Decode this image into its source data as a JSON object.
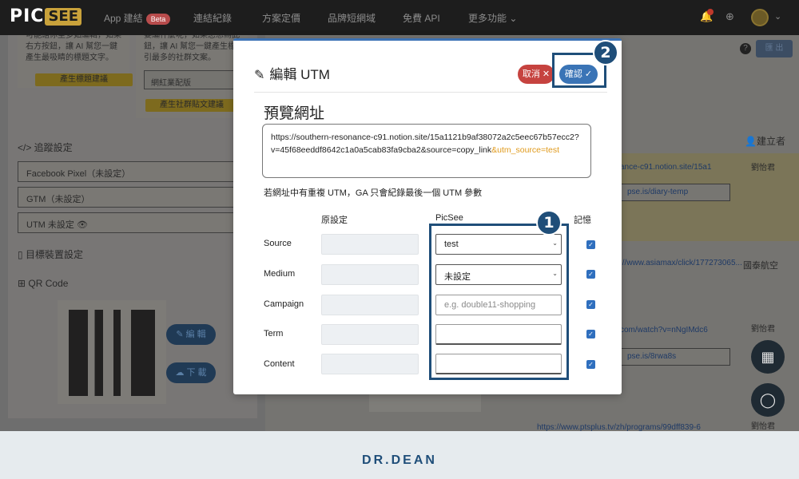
{
  "nav": {
    "logo_pic": "PIC",
    "logo_see": "SEE",
    "items": [
      "App 建結",
      "連結紀錄",
      "方案定價",
      "品牌短網域",
      "免費 API",
      "更多功能"
    ],
    "beta": "Beta",
    "more_caret": "⌄",
    "bell_icon": "🔔",
    "globe_icon": "⊕",
    "user_caret": "⌄"
  },
  "left": {
    "card1_lines": [
      "可能組你至多如編輯，如果",
      "右方按鈕，讓 AI 幫您一鍵",
      "產生最吸睛的標題文字。"
    ],
    "card1_button": "產生標題建議",
    "card2_lines": [
      "要編什麼呢，如果您想為此",
      "鈕，讓 AI 幫您一鍵產生標",
      "引最多的社群文案。"
    ],
    "card2_select": "網紅業配版",
    "card2_button": "產生社群貼文建議",
    "tracking_heading": "</> 追蹤設定",
    "tracking_items": [
      "Facebook Pixel（未設定）",
      "GTM（未設定）",
      "UTM 未設定 👁"
    ],
    "device_heading": "目標裝置設定",
    "qr_heading": "QR Code",
    "edit_button": "編 輯",
    "download_button": "下 載"
  },
  "right": {
    "creator_header": "建立者",
    "export": "匯 出",
    "links": [
      "ance-c91.notion.site/15a1",
      "://www.asiamax/click/177273065...",
      "com/watch?v=nNgIMdc6",
      "https://www.ptsplus.tv/zh/programs/99dff839-6"
    ],
    "shorts": [
      "pse.is/diary-temp",
      "pse.is/8rwa8s"
    ],
    "creators": [
      "劉怡君",
      "劉怡君",
      "劉怡君"
    ],
    "airline": "國泰航空"
  },
  "modal": {
    "title": "編輯 UTM",
    "cancel": "取消 ✕",
    "confirm": "確認 ✓",
    "preview_heading": "預覽網址",
    "preview_url_main": "https://southern-resonance-c91.notion.site/15a1121b9af38072a2c5eec67b57ecc2?v=45f68eeddf8642c1a0a5cab83fa9cba2&source=copy_link",
    "preview_url_utm": "&utm_source=test",
    "note": "若網址中有重複 UTM，GA 只會紀錄最後一個 UTM 參數",
    "col_original": "原設定",
    "col_picsee": "PicSee",
    "col_remember": "記憶",
    "rows": [
      {
        "label": "Source",
        "value": "test",
        "type": "select"
      },
      {
        "label": "Medium",
        "value": "未設定",
        "type": "select"
      },
      {
        "label": "Campaign",
        "value": "",
        "placeholder": "e.g. double11-shopping",
        "type": "input"
      },
      {
        "label": "Term",
        "value": "",
        "type": "input"
      },
      {
        "label": "Content",
        "value": "",
        "type": "input"
      }
    ]
  },
  "annotations": {
    "badge1": "1",
    "badge2": "2"
  },
  "footer": {
    "brand": "DR.DEAN"
  },
  "colors": {
    "accent": "#3a74b6",
    "danger": "#c6433f",
    "annotation": "#1f4e79",
    "highlight": "#e09a1c"
  }
}
